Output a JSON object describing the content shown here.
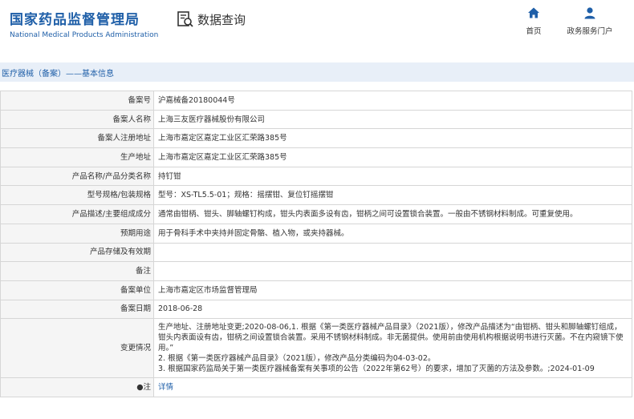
{
  "header": {
    "brand_cn": "国家药品监督管理局",
    "brand_en": "National Medical Products Administration",
    "data_query": "数据查询",
    "nav": [
      {
        "label": "首页",
        "icon": "home-icon"
      },
      {
        "label": "政务服务门户",
        "icon": "user-icon"
      }
    ],
    "accent_color": "#1f5fa8"
  },
  "breadcrumb": "医疗器械（备案）——基本信息",
  "table": {
    "rows": [
      {
        "label": "备案号",
        "value": "沪嘉械备20180044号"
      },
      {
        "label": "备案人名称",
        "value": "上海三友医疗器械股份有限公司"
      },
      {
        "label": "备案人注册地址",
        "value": "上海市嘉定区嘉定工业区汇荣路385号"
      },
      {
        "label": "生产地址",
        "value": "上海市嘉定区嘉定工业区汇荣路385号"
      },
      {
        "label": "产品名称/产品分类名称",
        "value": "持钉钳"
      },
      {
        "label": "型号规格/包装规格",
        "value": "型号：XS-TL5.5-01；规格：摇摆钳、复位钉摇摆钳"
      },
      {
        "label": "产品描述/主要组成成分",
        "value": "通常由钳柄、钳头、脚轴螺钉构成，钳头内表面多设有齿，钳柄之间可设置锁合装置。一般由不锈钢材料制成。可重复使用。"
      },
      {
        "label": "预期用途",
        "value": "用于骨科手术中夹持并固定骨骼、植入物，或夹持器械。"
      },
      {
        "label": "产品存储及有效期",
        "value": ""
      },
      {
        "label": "备注",
        "value": ""
      },
      {
        "label": "备案单位",
        "value": "上海市嘉定区市场监督管理局"
      },
      {
        "label": "备案日期",
        "value": "2018-06-28"
      }
    ],
    "change": {
      "label": "变更情况",
      "lines": [
        "生产地址、注册地址变更;2020-08-06,1. 根据《第一类医疗器械产品目录》（2021版），修改产品描述为“由钳柄、钳头和脚轴螺钉组成，钳头内表面设有齿，钳柄之间设置锁合装置。采用不锈钢材料制成。非无菌提供。使用前由使用机构根据说明书进行灭菌。不在内窥镜下使用。”",
        "2. 根据《第一类医疗器械产品目录》（2021版），修改产品分类编码为04-03-02。",
        "3. 根据国家药监局关于第一类医疗器械备案有关事项的公告（2022年第62号）的要求，增加了灭菌的方法及参数。;2024-01-09"
      ]
    },
    "note": {
      "label": "●注",
      "value": "详情"
    }
  }
}
